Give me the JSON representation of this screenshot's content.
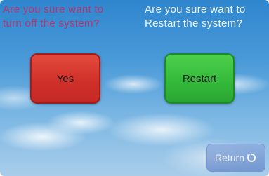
{
  "prompts": {
    "turn_off": "Are you sure want to\nturn off the system?",
    "restart": "Are you sure want to\nRestart the system?"
  },
  "buttons": {
    "yes_label": "Yes",
    "restart_label": "Restart",
    "return_label": "Return"
  },
  "colors": {
    "turn_off_prompt": "#b8346e",
    "yes_button": "#cf2f29",
    "restart_button": "#33b83a",
    "return_button": "#7a9bd6"
  },
  "icons": {
    "return": "return-arrow-icon"
  }
}
